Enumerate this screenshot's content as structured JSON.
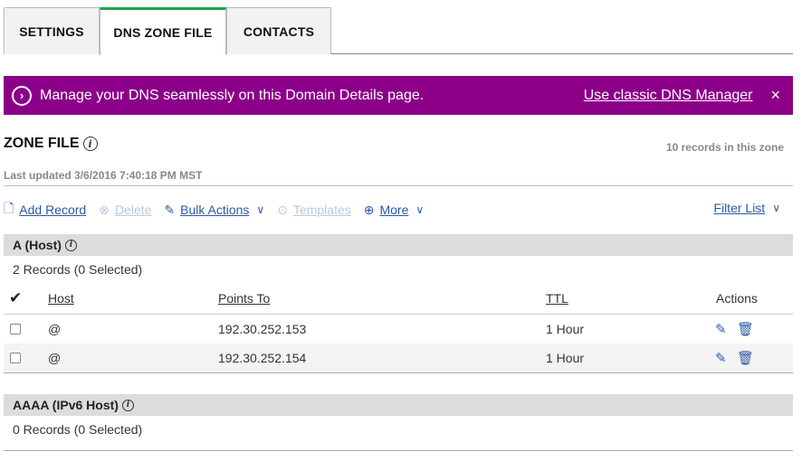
{
  "tabs": [
    {
      "label": "SETTINGS",
      "active": false
    },
    {
      "label": "DNS ZONE FILE",
      "active": true
    },
    {
      "label": "CONTACTS",
      "active": false
    }
  ],
  "banner": {
    "message": "Manage your DNS seamlessly on this Domain Details page.",
    "link": "Use classic DNS Manager",
    "close": "×",
    "bg_color": "#8c0089"
  },
  "zone": {
    "title": "ZONE FILE",
    "records_count": "10 records in this zone",
    "last_updated": "Last updated 3/6/2016 7:40:18 PM MST"
  },
  "toolbar": {
    "add_record": "Add Record",
    "delete": "Delete",
    "bulk_actions": "Bulk Actions",
    "templates": "Templates",
    "more": "More",
    "filter_list": "Filter List"
  },
  "sections": [
    {
      "title": "A (Host)",
      "count": "2 Records (0 Selected)",
      "columns": [
        "Host",
        "Points To",
        "TTL",
        "Actions"
      ],
      "rows": [
        {
          "host": "@",
          "points_to": "192.30.252.153",
          "ttl": "1 Hour"
        },
        {
          "host": "@",
          "points_to": "192.30.252.154",
          "ttl": "1 Hour"
        }
      ]
    },
    {
      "title": "AAAA (IPv6 Host)",
      "count": "0 Records (0 Selected)",
      "rows": []
    }
  ],
  "icons": {
    "info": "i",
    "banner_arrow": "›",
    "check": "✔",
    "add": "🗋",
    "delete": "⊗",
    "bulk": "✎",
    "templates": "⊙",
    "more": "⊕",
    "chevron": "∨",
    "edit": "✎",
    "trash": "🗑"
  },
  "colors": {
    "accent_tab": "#1ba74a",
    "link": "#2b5aa3"
  }
}
